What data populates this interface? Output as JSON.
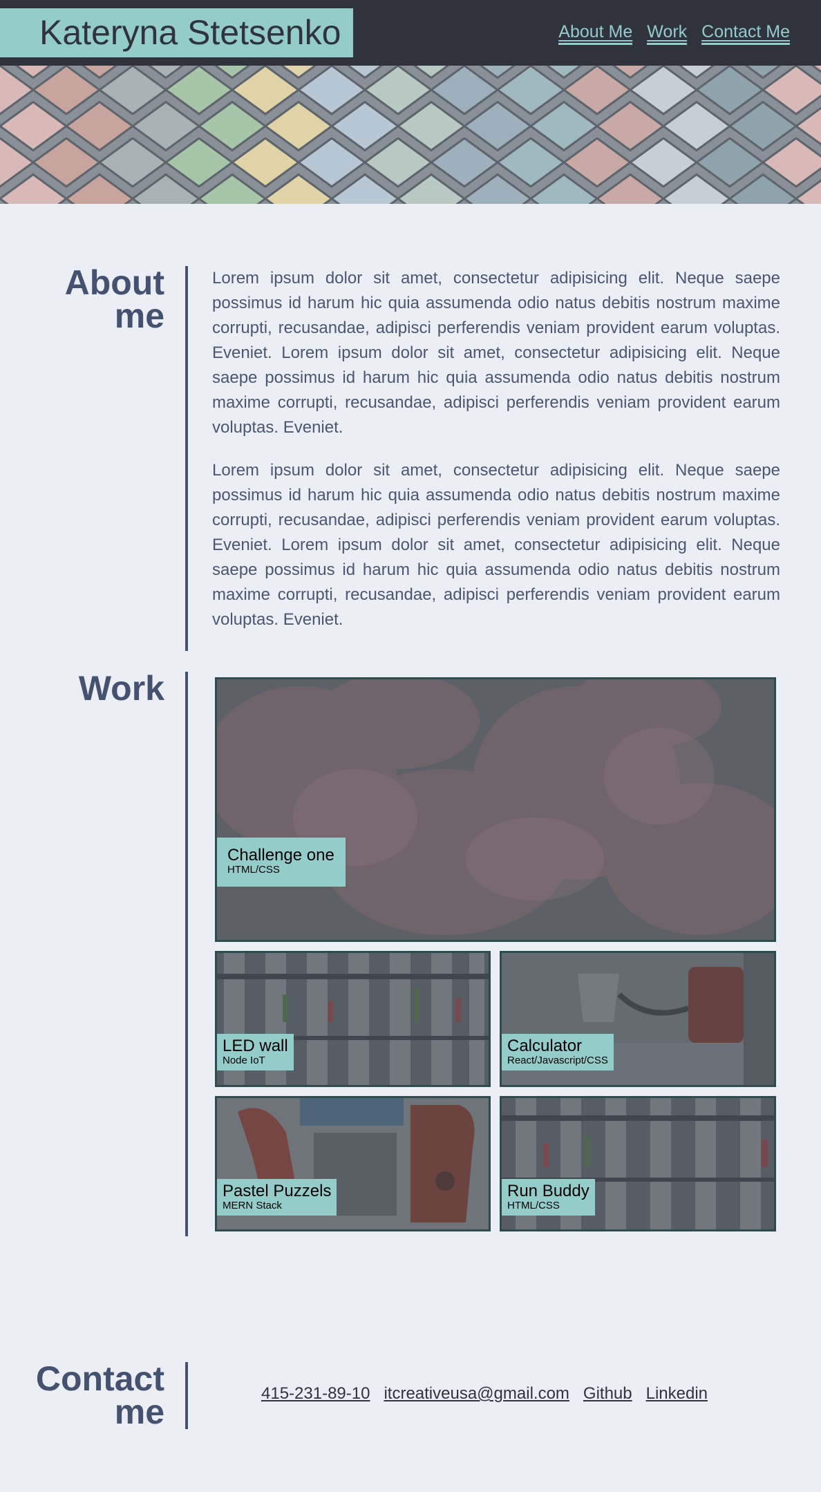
{
  "header": {
    "brand": "Kateryna Stetsenko",
    "nav": [
      {
        "label": "About Me"
      },
      {
        "label": "Work"
      },
      {
        "label": "Contact Me"
      }
    ]
  },
  "about": {
    "title_line1": "About",
    "title_line2": "me",
    "paragraphs": [
      "Lorem ipsum dolor sit amet, consectetur adipisicing elit. Neque saepe possimus id harum hic quia assumenda odio natus debitis nostrum maxime corrupti, recusandae, adipisci perferendis veniam provident earum voluptas. Eveniet. Lorem ipsum dolor sit amet, consectetur adipisicing elit. Neque saepe possimus id harum hic quia assumenda odio natus debitis nostrum maxime corrupti, recusandae, adipisci perferendis veniam provident earum voluptas. Eveniet.",
      "Lorem ipsum dolor sit amet, consectetur adipisicing elit. Neque saepe possimus id harum hic quia assumenda odio natus debitis nostrum maxime corrupti, recusandae, adipisci perferendis veniam provident earum voluptas. Eveniet. Lorem ipsum dolor sit amet, consectetur adipisicing elit. Neque saepe possimus id harum hic quia assumenda odio natus debitis nostrum maxime corrupti, recusandae, adipisci perferendis veniam provident earum voluptas. Eveniet."
    ]
  },
  "work": {
    "title": "Work",
    "projects": [
      {
        "title": "Challenge one",
        "tech": "HTML/CSS"
      },
      {
        "title": "LED wall",
        "tech": "Node IoT"
      },
      {
        "title": "Calculator",
        "tech": "React/Javascript/CSS"
      },
      {
        "title": "Pastel Puzzels",
        "tech": "MERN Stack"
      },
      {
        "title": "Run Buddy",
        "tech": "HTML/CSS"
      }
    ]
  },
  "contact": {
    "title_line1": "Contact",
    "title_line2": "me",
    "links": [
      {
        "label": "415-231-89-10"
      },
      {
        "label": "itcreativeusa@gmail.com"
      },
      {
        "label": "Github"
      },
      {
        "label": "Linkedin"
      }
    ]
  },
  "colors": {
    "header_bg": "#30333c",
    "accent": "#94ccc9",
    "page_bg": "#eceef6",
    "heading": "#44526f",
    "text": "#4b5670"
  }
}
